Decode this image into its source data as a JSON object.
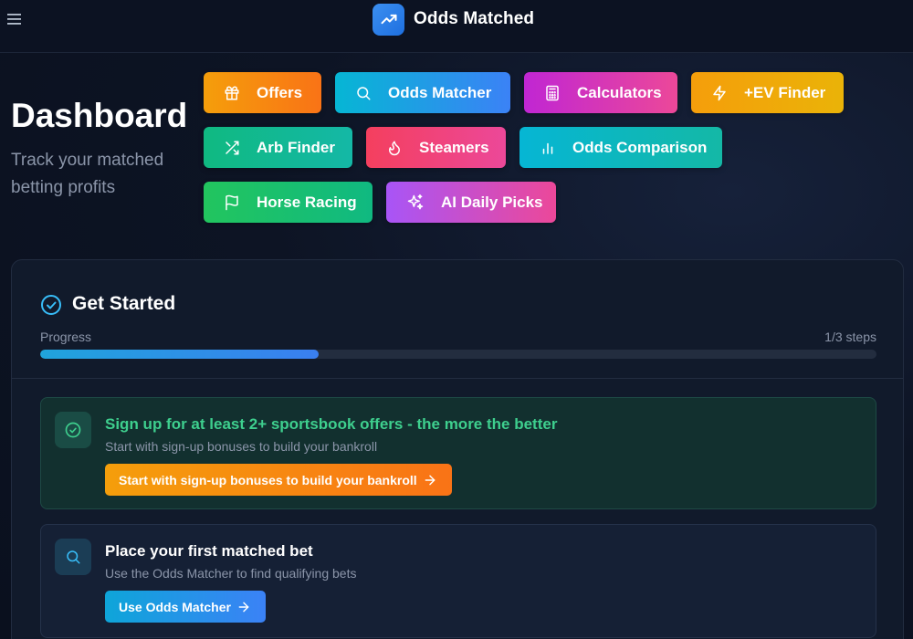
{
  "header": {
    "brand_name": "Odds Matched",
    "menu_icon": "hamburger-menu-icon",
    "logo_icon": "trending-up-icon"
  },
  "hero": {
    "title": "Dashboard",
    "subtitle": "Track your matched betting profits"
  },
  "nav_buttons": [
    {
      "label": "Offers",
      "icon": "gift-icon",
      "color": "#f97316"
    },
    {
      "label": "Odds Matcher",
      "icon": "search-icon",
      "color": "#0ea5e9"
    },
    {
      "label": "Calculators",
      "icon": "calculator-icon",
      "color": "#d946ef"
    },
    {
      "label": "+EV Finder",
      "icon": "lightning-icon",
      "color": "#f59e0b"
    },
    {
      "label": "Arb Finder",
      "icon": "shuffle-icon",
      "color": "#10b981"
    },
    {
      "label": "Steamers",
      "icon": "flame-icon",
      "color": "#f43f5e"
    },
    {
      "label": "Odds Comparison",
      "icon": "bar-chart-icon",
      "color": "#06b6d4"
    },
    {
      "label": "Horse Racing",
      "icon": "flag-icon",
      "color": "#22c55e"
    },
    {
      "label": "AI Daily Picks",
      "icon": "sparkles-icon",
      "color": "#a855f7"
    }
  ],
  "get_started": {
    "title": "Get Started",
    "progress_label": "Progress",
    "progress_steps": "1/3 steps",
    "progress_fraction": 0.333,
    "steps": [
      {
        "title": "Sign up for at least 2+ sportsbook offers - the more the better",
        "description": "Start with sign-up bonuses to build your bankroll",
        "cta": "Start with sign-up bonuses to build your bankroll",
        "icon": "check-circle-icon",
        "completed": true
      },
      {
        "title": "Place your first matched bet",
        "description": "Use the Odds Matcher to find qualifying bets",
        "cta": "Use Odds Matcher",
        "icon": "search-icon",
        "completed": false
      }
    ]
  }
}
